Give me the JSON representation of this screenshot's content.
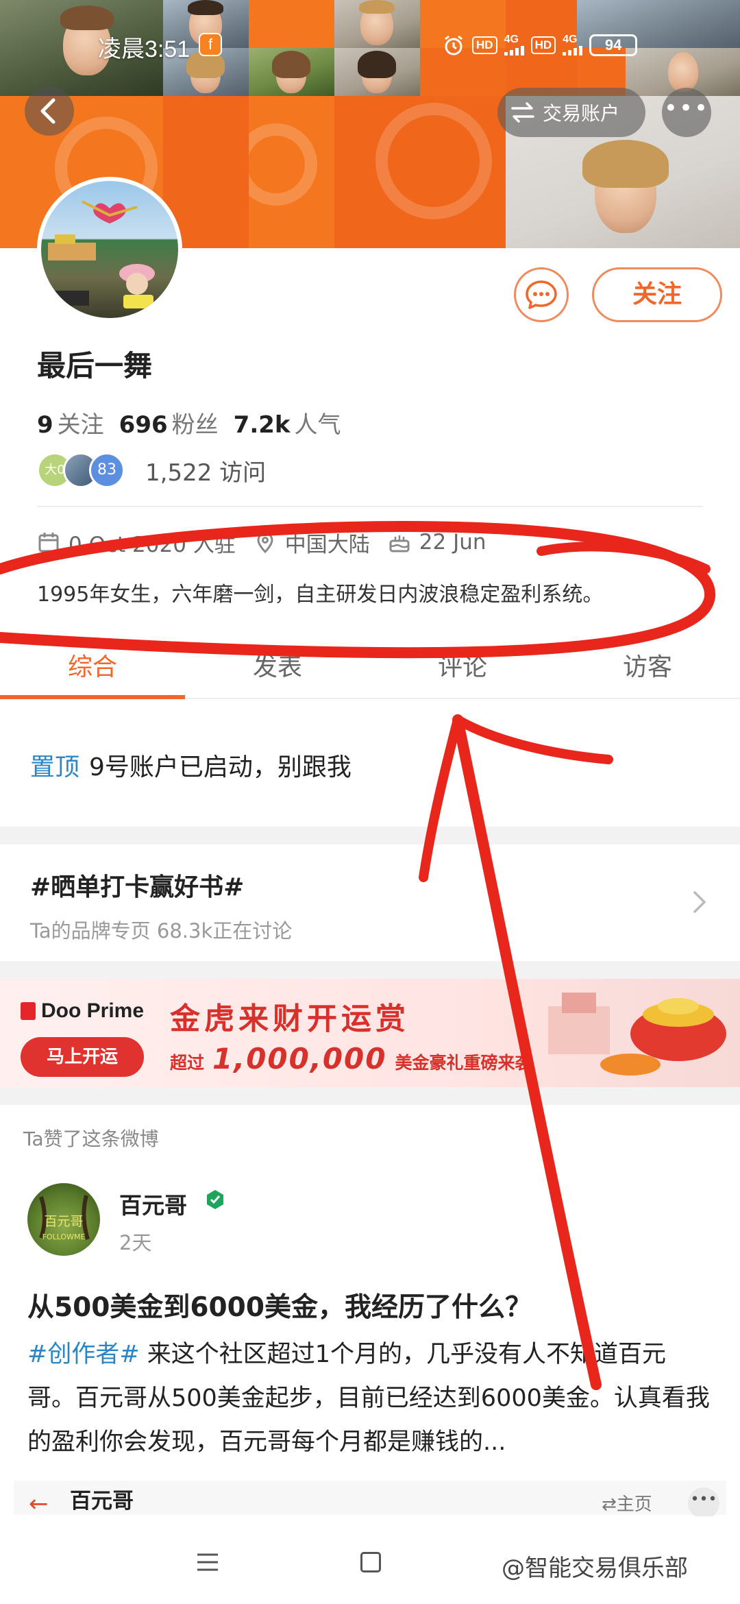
{
  "status_bar": {
    "time": "凌晨3:51",
    "app_badge": "f",
    "hd1": "HD",
    "net1": "4G",
    "hd2": "HD",
    "net2": "4G",
    "battery": "94"
  },
  "header": {
    "trade_account_label": "交易账户",
    "more_label": "•••"
  },
  "profile": {
    "name": "最后一舞",
    "follow_button": "关注",
    "following_count": "9",
    "following_label": "关注",
    "fans_count": "696",
    "fans_label": "粉丝",
    "popularity_count": "7.2k",
    "popularity_label": "人气",
    "visitor_avatars": [
      "大0",
      "",
      "83"
    ],
    "visits": "1,522 访问",
    "joined_visible": "0 Oct 2020 入驻",
    "location": "中国大陆",
    "birthday": "22 Jun",
    "bio": "1995年女生，六年磨一剑，自主研发日内波浪稳定盈利系统。"
  },
  "tabs": [
    {
      "label": "综合",
      "active": true
    },
    {
      "label": "发表",
      "active": false
    },
    {
      "label": "评论",
      "active": false
    },
    {
      "label": "访客",
      "active": false
    }
  ],
  "pinned": {
    "tag": "置顶",
    "text": "9号账户已启动，别跟我"
  },
  "topic": {
    "title": "#晒单打卡赢好书#",
    "subtitle": "Ta的品牌专页  68.3k正在讨论"
  },
  "ad": {
    "brand": "Doo Prime",
    "cta": "马上开运",
    "headline": "金虎来财开运赏",
    "line_prefix": "超过",
    "amount": "1,000,000",
    "line_suffix": "美金豪礼重磅来袭"
  },
  "feed": {
    "liked_note": "Ta赞了这条微博",
    "author": "百元哥",
    "author_avatar_text": "百元哥",
    "author_avatar_sub": "FOLLOWME",
    "time": "2天",
    "title": "从500美金到6000美金，我经历了什么？",
    "hashtag": "#创作者#",
    "body": " 来这个社区超过1个月的，几乎没有人不知道百元哥。百元哥从500美金起步，目前已经达到6000美金。认真看我的盈利你会发现，百元哥每个月都是赚钱的..."
  },
  "mini_bar": {
    "name": "百元哥",
    "home": "⇄主页",
    "dots": "•••"
  },
  "watermark": "@智能交易俱乐部",
  "colors": {
    "accent": "#f2662a",
    "link": "#2b86c5",
    "annotation_red": "#e8261c",
    "banner_orange": "#f47720"
  },
  "icons": {
    "back": "chevron-left-icon",
    "trade": "swap-arrows-icon",
    "message": "chat-bubble-icon",
    "calendar": "calendar-icon",
    "location": "location-pin-icon",
    "birthday": "cake-icon",
    "chevron": "chevron-right-icon",
    "verified": "verified-badge-icon"
  }
}
